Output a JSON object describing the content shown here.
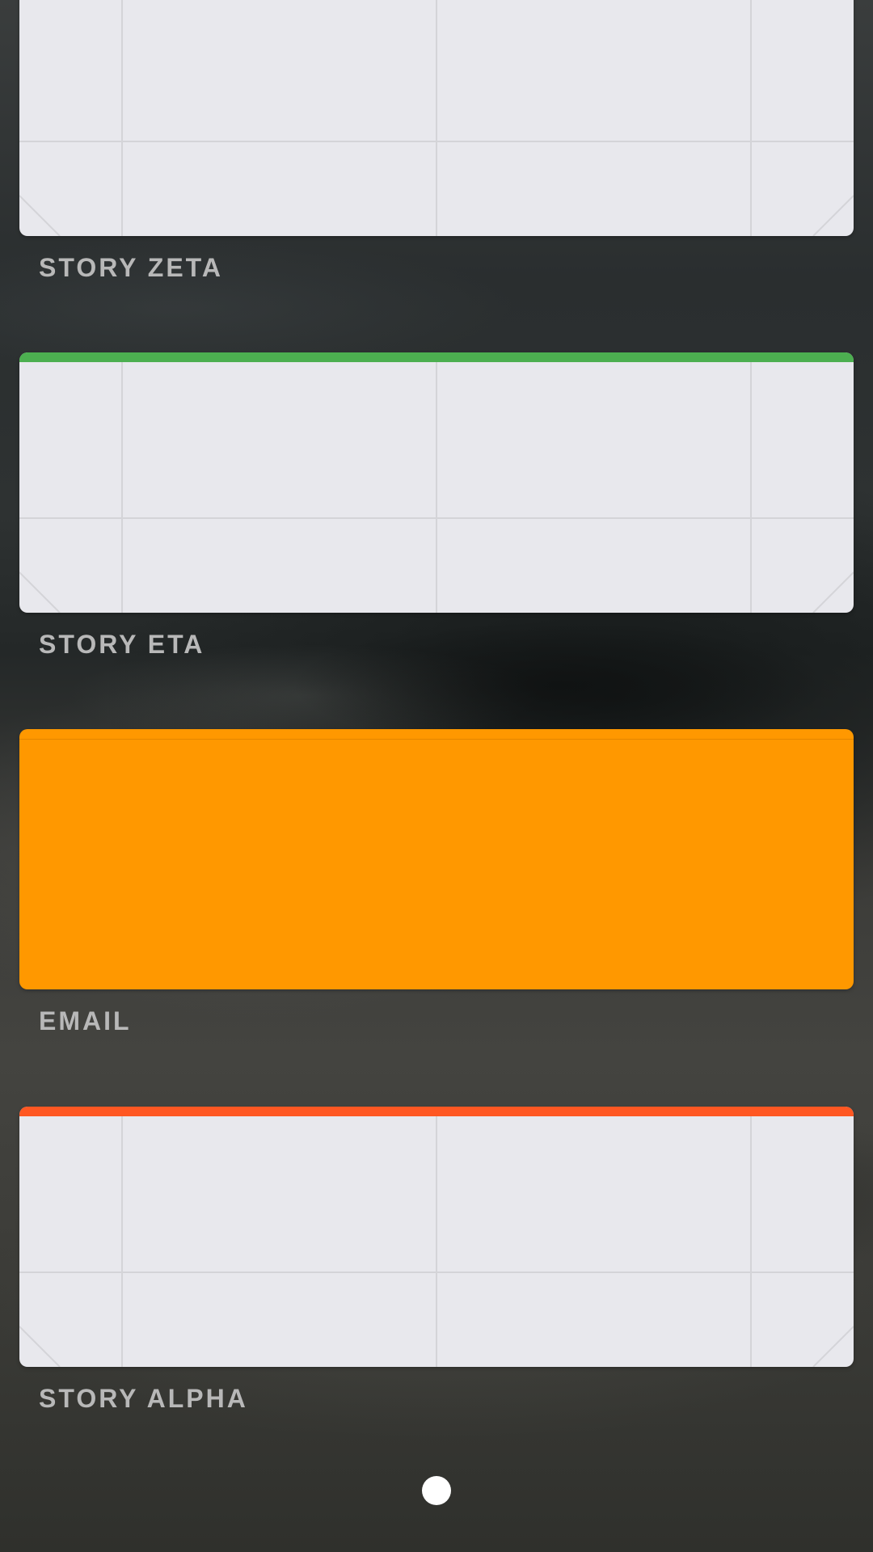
{
  "widgets": [
    {
      "label": "STORY ZETA",
      "accent_color": "#e8e8ed",
      "style": "grid-placeholder"
    },
    {
      "label": "STORY ETA",
      "accent_color": "#4caf50",
      "style": "grid-placeholder"
    },
    {
      "label": "EMAIL",
      "accent_color": "#ff9800",
      "style": "solid"
    },
    {
      "label": "STORY ALPHA",
      "accent_color": "#ff5722",
      "style": "grid-placeholder"
    }
  ],
  "pager": {
    "current_page": 1,
    "page_count": 1
  },
  "colors": {
    "card_background": "#e8e8ed",
    "grid_line": "#d4d4d8",
    "label_text": "#b8b8b8",
    "page_dot": "#ffffff"
  }
}
